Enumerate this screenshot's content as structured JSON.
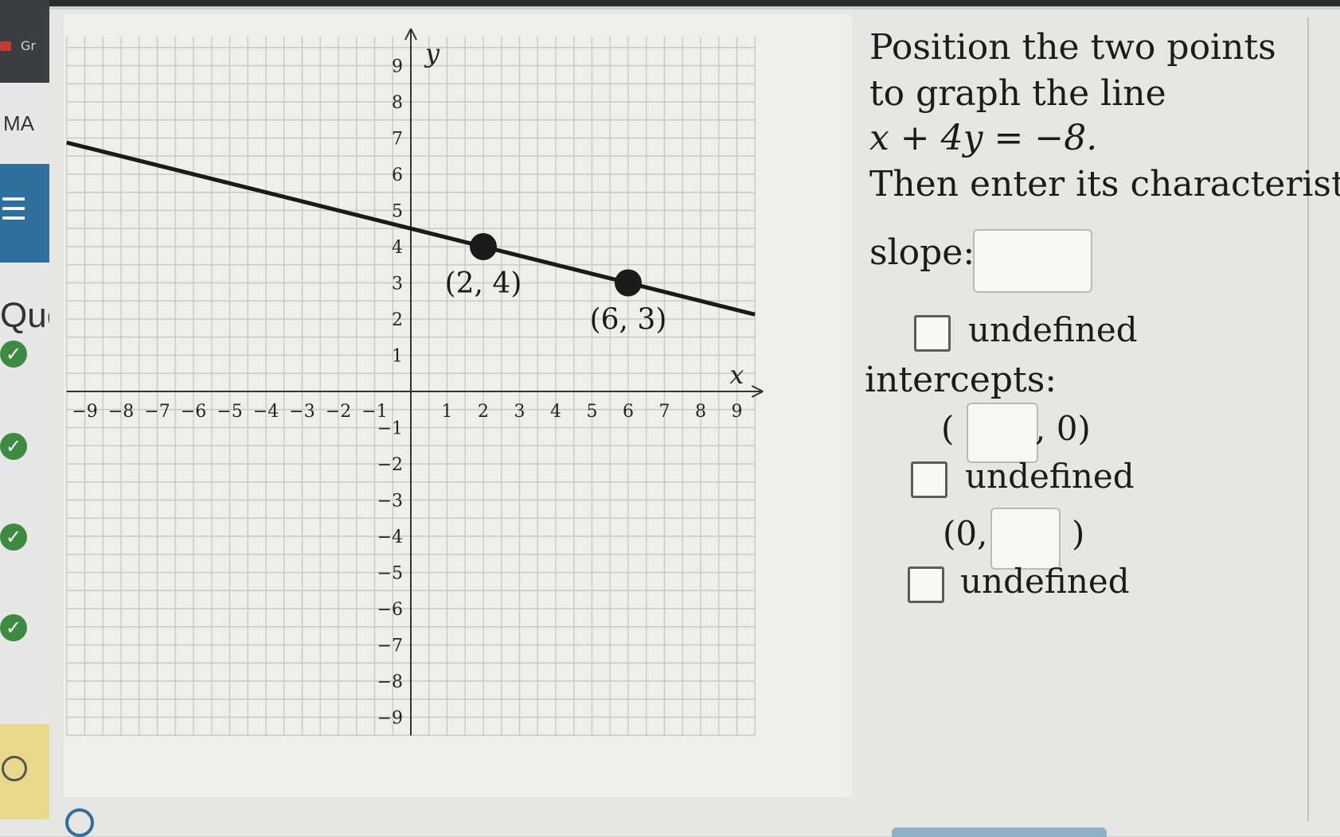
{
  "browser": {
    "tab_label": "Gr"
  },
  "sidebar": {
    "course_label": "MA",
    "menu_icon": "hamburger-menu-icon",
    "question_header": "Que",
    "question_status": [
      "correct",
      "correct",
      "correct",
      "correct",
      "unanswered"
    ]
  },
  "graph": {
    "x_axis_label": "x",
    "y_axis_label": "y",
    "x_ticks": [
      "−9",
      "−8",
      "−7",
      "−6",
      "−5",
      "−4",
      "−3",
      "−2",
      "−1",
      "1",
      "2",
      "3",
      "4",
      "5",
      "6",
      "7",
      "8",
      "9"
    ],
    "y_ticks": [
      "9",
      "8",
      "7",
      "6",
      "5",
      "4",
      "3",
      "2",
      "1",
      "−1",
      "−2",
      "−3",
      "−4",
      "−5",
      "−6",
      "−7",
      "−8",
      "−9"
    ],
    "points": [
      {
        "label": "(2, 4)",
        "x": 2,
        "y": 4
      },
      {
        "label": "(6, 3)",
        "x": 6,
        "y": 3
      }
    ],
    "line": {
      "slope": -0.25,
      "intercept": 4.5
    }
  },
  "question": {
    "line1": "Position the two points",
    "line2": "to graph the line",
    "equation": "x + 4y = −8.",
    "line4": "Then enter its characteristics.",
    "slope_label": "slope:",
    "slope_value": "",
    "undefined_label": "undefined",
    "intercepts_label": "intercepts:",
    "x_intercept_prefix": "(",
    "x_intercept_suffix": ", 0)",
    "x_intercept_value": "",
    "y_intercept_prefix": "(0,",
    "y_intercept_suffix": ")",
    "y_intercept_value": ""
  },
  "colors": {
    "line": "#1a1a1a",
    "grid": "#c9cac8",
    "axis": "#333333",
    "check": "#3d8b40",
    "menu": "#2e6f9e"
  },
  "footer": {
    "settings_icon": "lifebuoy-icon"
  }
}
